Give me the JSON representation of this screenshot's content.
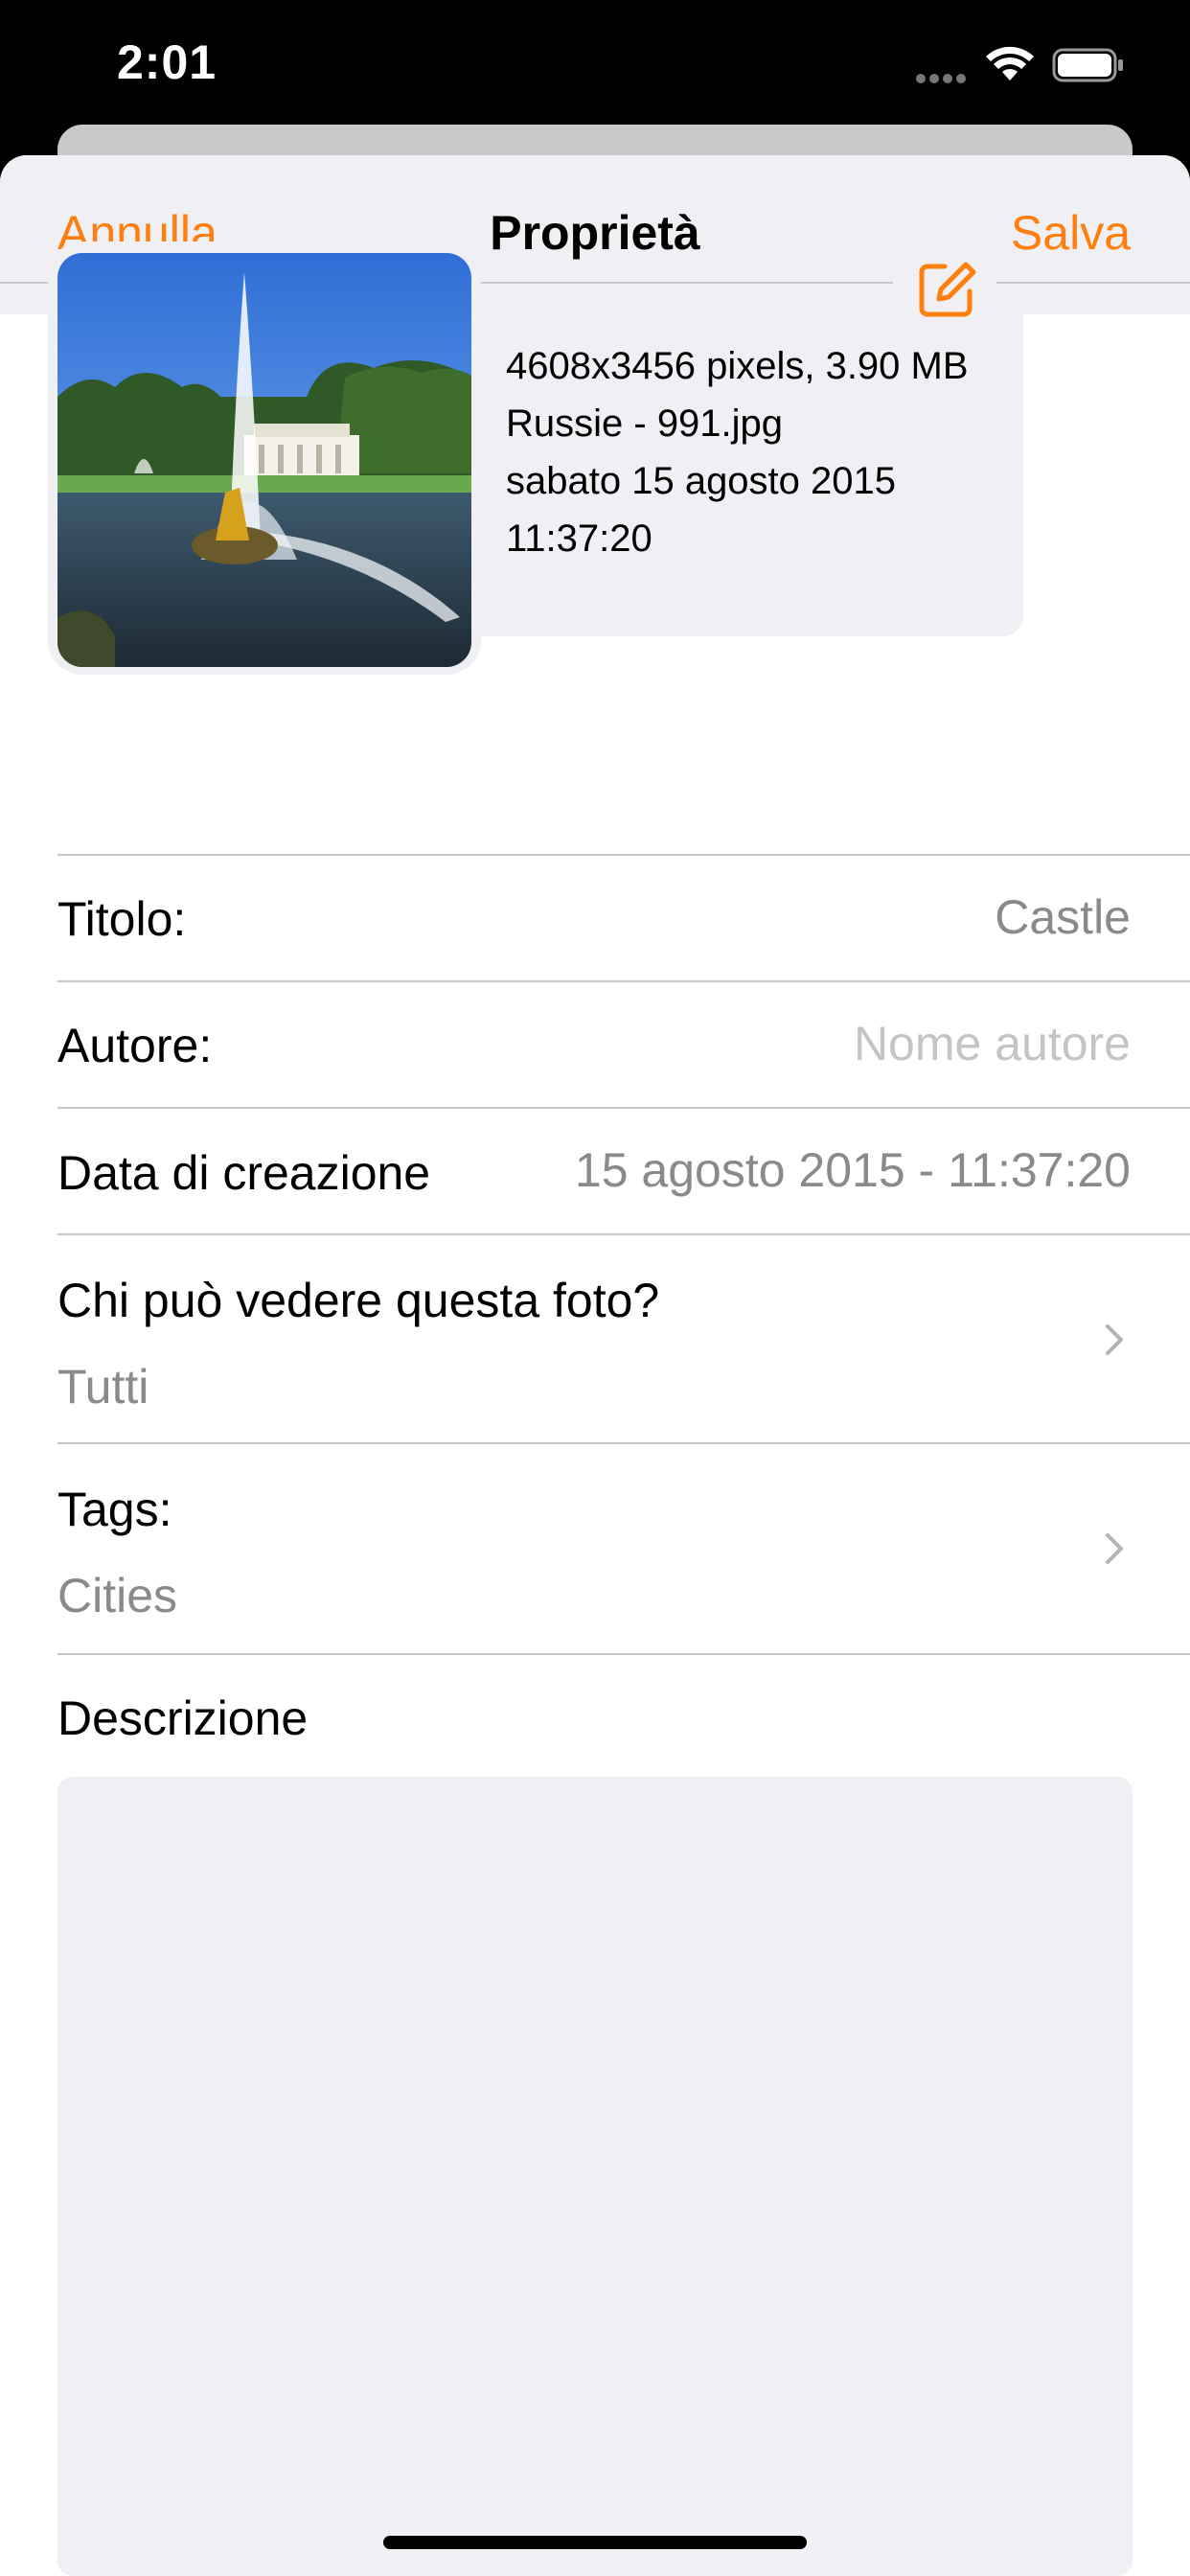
{
  "status_bar": {
    "time": "2:01"
  },
  "navbar": {
    "cancel_label": "Annulla",
    "title": "Proprietà",
    "save_label": "Salva"
  },
  "photo": {
    "dimensions_size": "4608x3456 pixels, 3.90 MB",
    "filename": "Russie - 991.jpg",
    "date": "sabato 15 agosto 2015",
    "time": "11:37:20"
  },
  "fields": {
    "title": {
      "label": "Titolo:",
      "value": "Castle"
    },
    "author": {
      "label": "Autore:",
      "placeholder": "Nome autore"
    },
    "creation_date": {
      "label": "Data di creazione",
      "value": "15 agosto 2015 - 11:37:20"
    },
    "privacy": {
      "label": "Chi può vedere questa foto?",
      "value": "Tutti"
    },
    "tags": {
      "label": "Tags:",
      "value": "Cities"
    },
    "description": {
      "label": "Descrizione",
      "value": ""
    }
  },
  "colors": {
    "accent": "#ff7f0e",
    "grouped_background": "#efeff4",
    "separator": "#c8c7cc",
    "secondary_text": "#8a8a8e"
  },
  "icons": [
    "wifi-icon",
    "battery-icon",
    "edit-icon",
    "chevron-right-icon"
  ]
}
